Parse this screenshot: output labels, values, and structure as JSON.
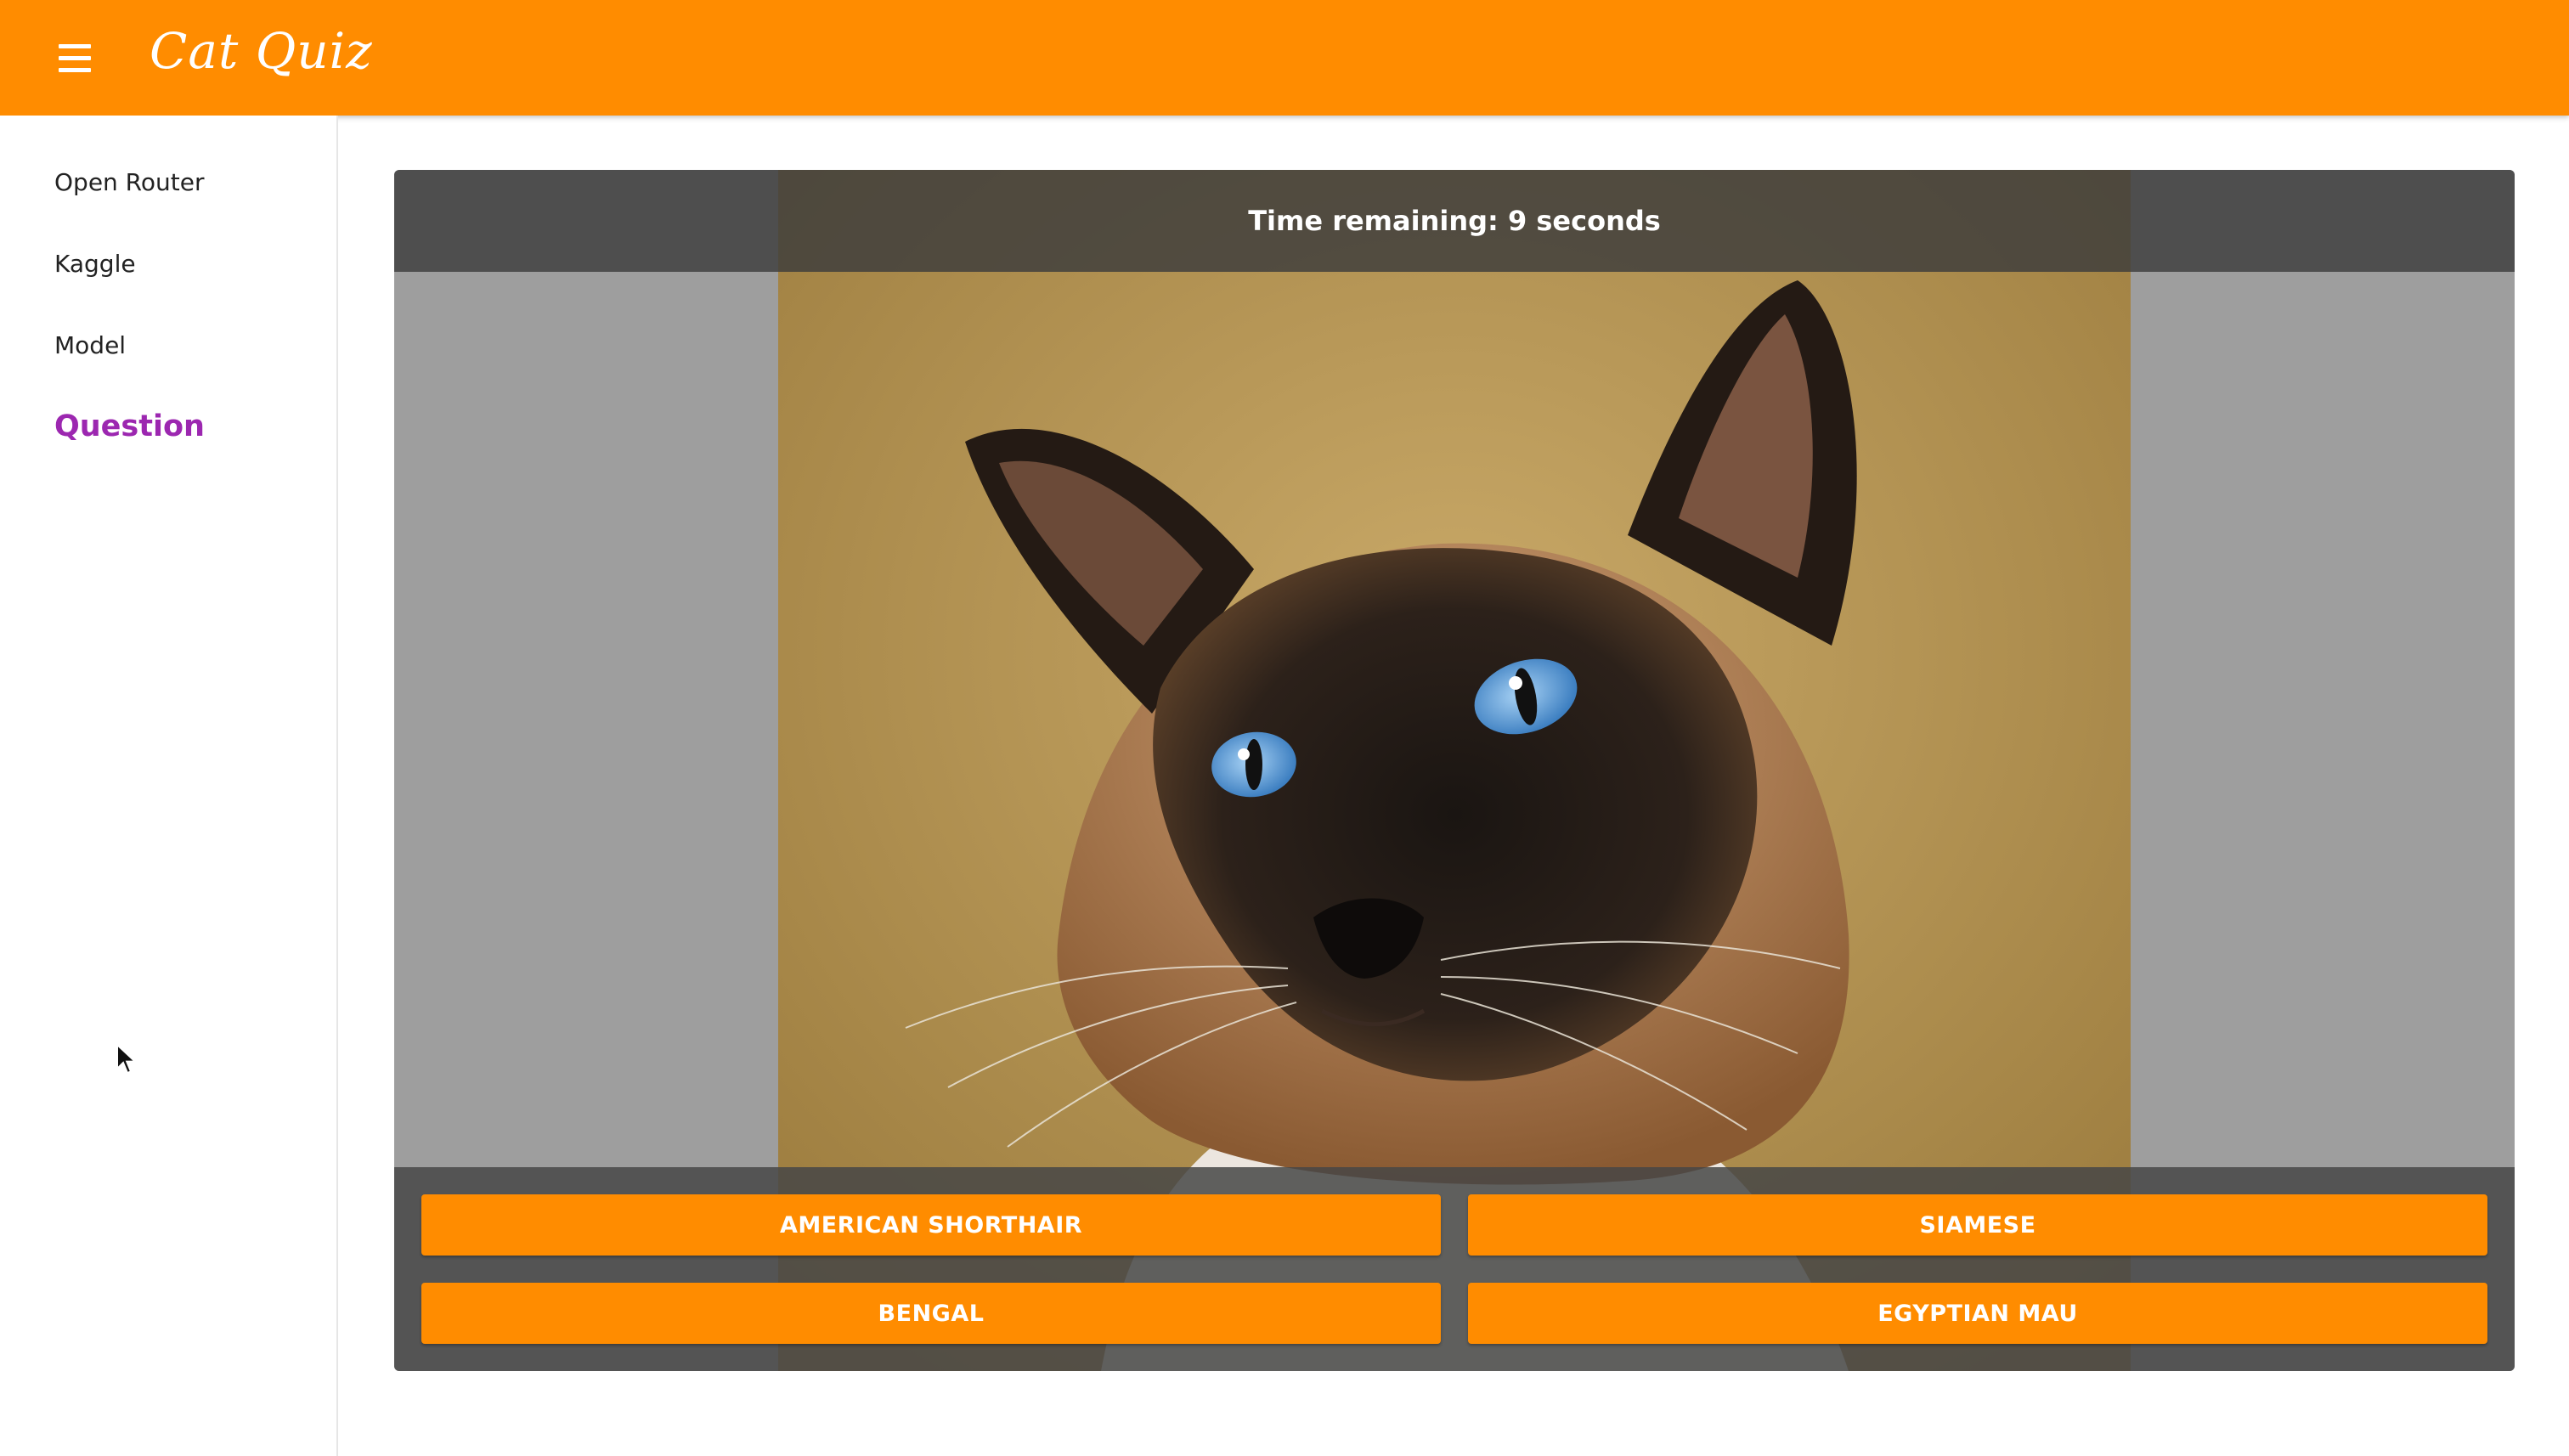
{
  "app": {
    "title": "Cat Quiz"
  },
  "sidebar": {
    "items": [
      {
        "label": "Open Router",
        "active": false
      },
      {
        "label": "Kaggle",
        "active": false
      },
      {
        "label": "Model",
        "active": false
      },
      {
        "label": "Question",
        "active": true
      }
    ]
  },
  "quiz": {
    "timer_text": "Time remaining: 9 seconds",
    "image_subject": "siamese cat photo",
    "answers": [
      "AMERICAN SHORTHAIR",
      "SIAMESE",
      "BENGAL",
      "EGYPTIAN MAU"
    ]
  },
  "colors": {
    "accent": "#ff8c00",
    "active_nav": "#9c27b0",
    "frame_gray": "#9e9e9e"
  },
  "icons": {
    "menu": "hamburger-menu-icon",
    "cursor": "mouse-pointer-icon"
  }
}
